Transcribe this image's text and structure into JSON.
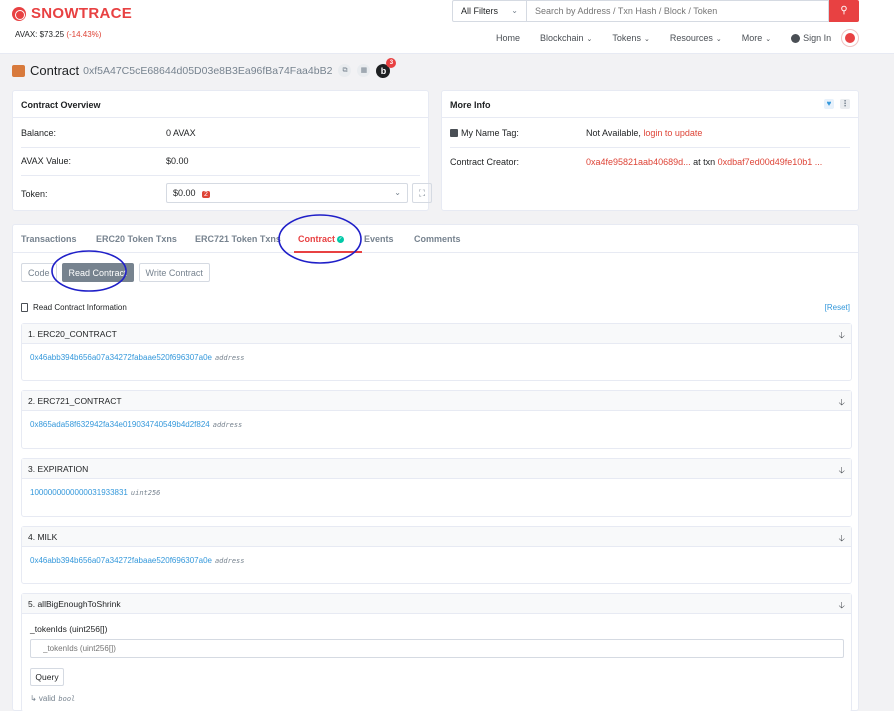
{
  "header": {
    "logo_text": "SNOWTRACE",
    "price_label": "AVAX: $73.25",
    "price_change": "(-14.43%)",
    "filter_label": "All Filters",
    "search_placeholder": "Search by Address / Txn Hash / Block / Token",
    "nav": [
      "Home",
      "Blockchain",
      "Tokens",
      "Resources",
      "More"
    ],
    "signin": "Sign In",
    "colors": {
      "brand": "#e84142"
    }
  },
  "title": {
    "label": "Contract",
    "address": "0xf5A47C5cE68644d05D03e8B3Ea96fBa74Faa4bB2",
    "badge_count": "3"
  },
  "overview": {
    "header": "Contract Overview",
    "balance_label": "Balance:",
    "balance_value": "0 AVAX",
    "value_label": "AVAX Value:",
    "value_value": "$0.00",
    "token_label": "Token:",
    "token_value": "$0.00",
    "token_badge": "2"
  },
  "more_info": {
    "header": "More Info",
    "name_tag_label": "My Name Tag:",
    "name_tag_value": "Not Available,",
    "name_tag_link": "login to update",
    "creator_label": "Contract Creator:",
    "creator_address": "0xa4fe95821aab40689d...",
    "at_txn": "at txn",
    "creator_txn": "0xdbaf7ed00d49fe10b1 ..."
  },
  "tabs": [
    "Transactions",
    "ERC20 Token Txns",
    "ERC721 Token Txns",
    "Contract",
    "Events",
    "Comments"
  ],
  "subtabs": [
    "Code",
    "Read Contract",
    "Write Contract"
  ],
  "read_info": "Read Contract Information",
  "reset": "[Reset]",
  "functions": [
    {
      "title": "1. ERC20_CONTRACT",
      "value": "0x46abb394b656a07a34272fabaae520f696307a0e",
      "type": "address"
    },
    {
      "title": "2. ERC721_CONTRACT",
      "value": "0x865ada58f632942fa34e019034740549b4d2f824",
      "type": "address"
    },
    {
      "title": "3. EXPIRATION",
      "value": "1000000000000031933831",
      "type": "uint256"
    },
    {
      "title": "4. MILK",
      "value": "0x46abb394b656a07a34272fabaae520f696307a0e",
      "type": "address"
    }
  ],
  "func5": {
    "title": "5. allBigEnoughToShrink",
    "param_label": "_tokenIds (uint256[])",
    "param_placeholder": "_tokenIds (uint256[])",
    "query_label": "Query",
    "result_prefix": "↳ valid",
    "result_type": "bool"
  }
}
